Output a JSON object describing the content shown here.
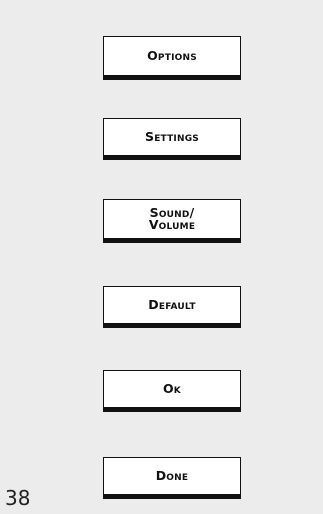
{
  "buttons": {
    "options": "Options",
    "settings": "Settings",
    "sound_volume_line1": "Sound/",
    "sound_volume_line2": "Volume",
    "default": "Default",
    "ok": "Ok",
    "done": "Done"
  },
  "page_number": "38",
  "colors": {
    "background": "#ececec",
    "key_face": "#ffffff",
    "key_border": "#111111"
  }
}
